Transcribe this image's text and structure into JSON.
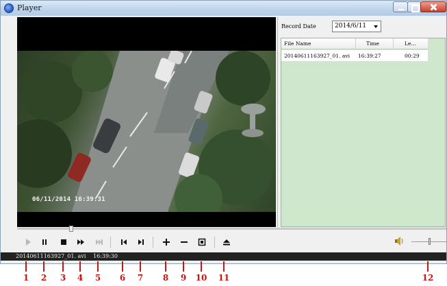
{
  "window": {
    "title": "Player"
  },
  "video": {
    "overlay_timestamp": "06/11/2014 16:39:31"
  },
  "panel": {
    "record_date_label": "Record Date",
    "record_date_value": "2014/6/11",
    "columns": [
      "File Name",
      "Time",
      "Le..."
    ],
    "rows": [
      {
        "file_name": "20140611163927_01. avi",
        "time": "16:39:27",
        "length": "00:29"
      }
    ]
  },
  "controls": {
    "icons": [
      "play-icon",
      "pause-icon",
      "stop-icon",
      "fast-forward-icon",
      "skip-end-icon",
      "prev-frame-icon",
      "next-frame-icon",
      "zoom-in-icon",
      "zoom-out-icon",
      "fullscreen-icon",
      "eject-icon",
      "speaker-icon"
    ]
  },
  "status": {
    "file": "20140611163927_01. avi",
    "time": "16:39:30"
  },
  "annotations": [
    "1",
    "2",
    "3",
    "4",
    "5",
    "6",
    "7",
    "8",
    "9",
    "10",
    "11",
    "12"
  ],
  "colors": {
    "annotation": "#cc1111",
    "list_background": "#cfe8cd",
    "status_bar": "#222222"
  }
}
